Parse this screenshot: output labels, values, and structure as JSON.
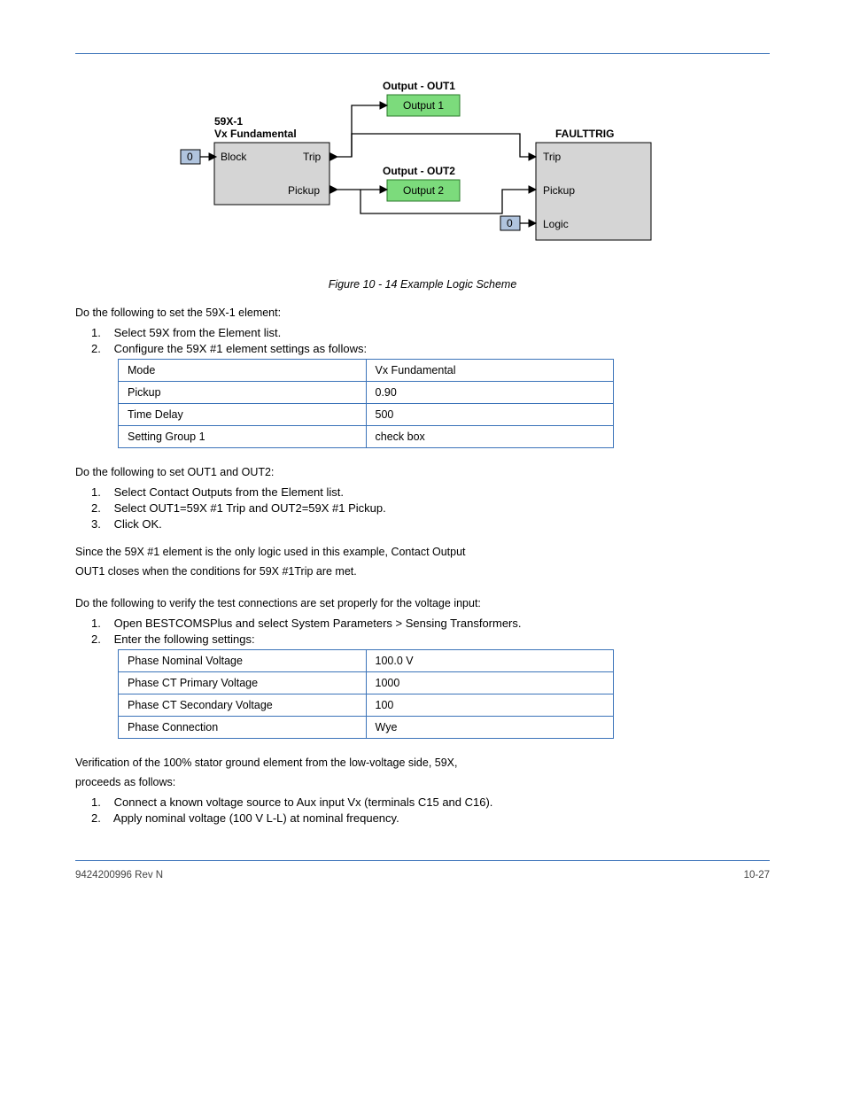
{
  "diagram": {
    "block59x1": {
      "title1": "59X-1",
      "title2": "Vx Fundamental",
      "in_block": "Block",
      "out_trip": "Trip",
      "out_pickup": "Pickup"
    },
    "const0a": "0",
    "const0b": "0",
    "out1": {
      "title": "Output - OUT1",
      "label": "Output 1"
    },
    "out2": {
      "title": "Output - OUT2",
      "label": "Output 2"
    },
    "faulttrig": {
      "title": "FAULTTRIG",
      "trip": "Trip",
      "pickup": "Pickup",
      "logic": "Logic"
    }
  },
  "figure_caption": "Figure 10 - 14 Example Logic Scheme",
  "intro1": "Do the following to set the 59X-1 element:",
  "step1": {
    "num": "1.",
    "text": "Select 59X from the Element list."
  },
  "step2": {
    "num": "2.",
    "text": "Configure the 59X #1 element settings as follows:"
  },
  "table1": [
    [
      "Mode",
      "Vx Fundamental"
    ],
    [
      "Pickup",
      "0.90"
    ],
    [
      "Time Delay",
      "500"
    ],
    [
      "Setting Group 1",
      "check box"
    ]
  ],
  "intro2": "Do the following to set OUT1 and OUT2:",
  "out_step1": {
    "num": "1.",
    "text": "Select Contact Outputs from the Element list."
  },
  "out_step2": {
    "num": "2.",
    "text": "Select OUT1=59X #1 Trip and OUT2=59X #1 Pickup."
  },
  "out_step3": {
    "num": "3.",
    "text": "Click OK."
  },
  "intro3a": "Since the 59X #1 element is the only logic used in this example, Contact Output",
  "intro3b": "OUT1 closes when the conditions for 59X #1Trip are met.",
  "intro4": "Do the following to verify the test connections are set properly for the voltage input:",
  "sys_step1": {
    "num": "1.",
    "text": "Open BESTCOMSPlus and select System Parameters > Sensing Transformers."
  },
  "sys_step2": {
    "num": "2.",
    "text": "Enter the following settings:"
  },
  "table2": [
    [
      "Phase Nominal Voltage",
      "100.0 V"
    ],
    [
      "Phase CT Primary Voltage",
      "1000"
    ],
    [
      "Phase CT Secondary Voltage",
      "100"
    ],
    [
      "Phase Connection",
      "Wye"
    ]
  ],
  "intro5": "Verification of the 100% stator ground element from the low-voltage side, 59X,",
  "intro5b": "proceeds as follows:",
  "v_step1": {
    "num": "1.",
    "text": "Connect a known voltage source to Aux input Vx (terminals C15 and C16)."
  },
  "v_step2": {
    "num": "2.",
    "text": "Apply nominal voltage (100 V L-L) at nominal frequency."
  },
  "footer": {
    "left": "9424200996 Rev N",
    "right": "10-27"
  }
}
